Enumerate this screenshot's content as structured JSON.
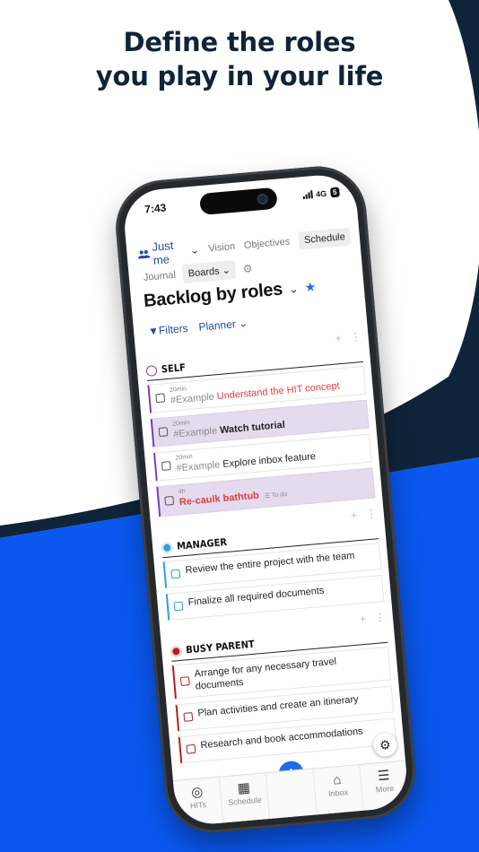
{
  "headline": {
    "line1": "Define the roles",
    "line2": "you play in your life"
  },
  "colors": {
    "navy": "#0f2439",
    "blue": "#0a58f0",
    "accent": "#1e6ce8"
  },
  "status_bar": {
    "time": "7:43",
    "network": "4G",
    "battery": "5"
  },
  "nav": {
    "just_me": "Just me",
    "vision": "Vision",
    "objectives": "Objectives",
    "schedule": "Schedule",
    "journal": "Journal",
    "boards": "Boards"
  },
  "page": {
    "title": "Backlog by roles",
    "filters": "Filters",
    "planner": "Planner"
  },
  "sections": {
    "self": {
      "name": "SELF",
      "tasks": [
        {
          "duration": "20min",
          "tag": "#Example",
          "text": "Understand the HIT concept"
        },
        {
          "duration": "20min",
          "tag": "#Example",
          "text": "Watch tutorial"
        },
        {
          "duration": "20min",
          "tag": "#Example",
          "text": "Explore inbox feature"
        },
        {
          "duration": "4h",
          "text": "Re-caulk bathtub",
          "status": "To do"
        }
      ]
    },
    "manager": {
      "name": "MANAGER",
      "tasks": [
        {
          "text": "Review the entire project with the team"
        },
        {
          "text": "Finalize all required documents"
        }
      ]
    },
    "busy_parent": {
      "name": "BUSY PARENT",
      "tasks": [
        {
          "text": "Arrange for any necessary travel documents"
        },
        {
          "text": "Plan activities and create an itinerary"
        },
        {
          "text": "Research and book accommodations"
        }
      ]
    }
  },
  "tabbar": {
    "hits": "HITs",
    "schedule": "Schedule",
    "inbox": "Inbox",
    "more": "More"
  },
  "icons": [
    "users-icon",
    "chevron-down-icon",
    "gear-icon",
    "star-icon",
    "filter-icon",
    "plus-icon",
    "more-vertical-icon",
    "checkbox-icon",
    "list-icon",
    "compass-icon",
    "calendar-icon",
    "inbox-icon",
    "menu-icon"
  ]
}
